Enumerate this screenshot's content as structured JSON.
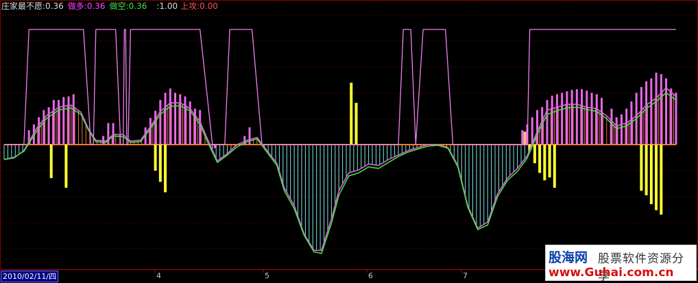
{
  "header": {
    "indicator_name": "庄家最不愿",
    "zjbv": ":0.36",
    "long_label": "做多",
    "long_value": ":0.36",
    "short_label": "做空",
    "short_value": ":0.36",
    "v4": ":1.00",
    "attack_label": "上攻",
    "attack_value": ":0.00"
  },
  "x_axis": {
    "date_label": "2010/02/11/四",
    "month_labels": [
      "4",
      "5",
      "6",
      "7"
    ]
  },
  "watermark": {
    "brand": "股海网",
    "tagline": "股票软件资源分享",
    "url": "www.Guhai.com.cn"
  },
  "colors": {
    "background": "#000000",
    "grid": "#8b0000",
    "zero_line": "#ff7a1a",
    "long_line": "#e060e0",
    "short_line": "#40e040",
    "positive_hist": "#e07a4a",
    "negative_hist": "#7fe8e8",
    "signal": "#ffff30",
    "signal_light": "#ffc080",
    "attack_bar": "#e868e8",
    "step_line": "#f080f0",
    "label_name": "#d8d8d8",
    "label_long": "#ff40ff",
    "label_short": "#40e040",
    "label_attack": "#ff5050"
  },
  "chart_data": {
    "type": "line",
    "title": "",
    "xlabel": "",
    "ylabel": "",
    "ylim": [
      -1.6,
      1.8
    ],
    "zero": 0,
    "grid": true,
    "bars_count": 138,
    "series": [
      {
        "name": "做多",
        "points": [
          [
            0,
            -0.2
          ],
          [
            4,
            -0.18
          ],
          [
            8,
            -0.08
          ],
          [
            13,
            0.22
          ],
          [
            17,
            0.4
          ],
          [
            22,
            0.52
          ],
          [
            27,
            0.55
          ],
          [
            31,
            0.45
          ],
          [
            34,
            0.22
          ],
          [
            37,
            0.06
          ],
          [
            41,
            0.05
          ],
          [
            44,
            0.14
          ],
          [
            48,
            0.14
          ],
          [
            51,
            0.05
          ],
          [
            55,
            0.06
          ],
          [
            59,
            0.25
          ],
          [
            63,
            0.46
          ],
          [
            67,
            0.58
          ],
          [
            71,
            0.58
          ],
          [
            75,
            0.5
          ],
          [
            79,
            0.32
          ],
          [
            82,
            0.08
          ],
          [
            86,
            -0.22
          ],
          [
            90,
            -0.12
          ],
          [
            94,
            0.0
          ],
          [
            98,
            0.06
          ],
          [
            102,
            0.1
          ],
          [
            106,
            -0.08
          ],
          [
            110,
            -0.25
          ],
          [
            113,
            -0.58
          ],
          [
            117,
            -0.82
          ],
          [
            121,
            -1.2
          ],
          [
            125,
            -1.42
          ],
          [
            128,
            -1.42
          ],
          [
            132,
            -1.0
          ],
          [
            135,
            -0.62
          ],
          [
            139,
            -0.38
          ],
          [
            143,
            -0.34
          ],
          [
            147,
            -0.26
          ],
          [
            151,
            -0.28
          ],
          [
            155,
            -0.2
          ],
          [
            159,
            -0.14
          ],
          [
            163,
            -0.08
          ],
          [
            167,
            -0.04
          ],
          [
            171,
            0.0
          ],
          [
            175,
            0.0
          ],
          [
            179,
            -0.04
          ],
          [
            183,
            -0.28
          ],
          [
            187,
            -0.82
          ],
          [
            191,
            -1.12
          ],
          [
            195,
            -1.04
          ],
          [
            199,
            -0.66
          ],
          [
            203,
            -0.45
          ],
          [
            207,
            -0.32
          ],
          [
            211,
            -0.15
          ],
          [
            215,
            0.18
          ],
          [
            219,
            0.48
          ],
          [
            223,
            0.52
          ],
          [
            227,
            0.56
          ],
          [
            231,
            0.56
          ],
          [
            235,
            0.52
          ],
          [
            239,
            0.5
          ],
          [
            243,
            0.4
          ],
          [
            247,
            0.26
          ],
          [
            251,
            0.3
          ],
          [
            255,
            0.4
          ],
          [
            259,
            0.55
          ],
          [
            263,
            0.65
          ],
          [
            267,
            0.79
          ],
          [
            271,
            0.67
          ]
        ]
      },
      {
        "name": "做空",
        "points": [
          [
            0,
            -0.2
          ],
          [
            4,
            -0.17
          ],
          [
            8,
            -0.09
          ],
          [
            13,
            0.18
          ],
          [
            17,
            0.36
          ],
          [
            22,
            0.48
          ],
          [
            27,
            0.51
          ],
          [
            31,
            0.42
          ],
          [
            34,
            0.2
          ],
          [
            37,
            0.04
          ],
          [
            41,
            0.03
          ],
          [
            44,
            0.12
          ],
          [
            48,
            0.11
          ],
          [
            51,
            0.03
          ],
          [
            55,
            0.04
          ],
          [
            59,
            0.22
          ],
          [
            63,
            0.42
          ],
          [
            67,
            0.53
          ],
          [
            71,
            0.54
          ],
          [
            75,
            0.47
          ],
          [
            79,
            0.28
          ],
          [
            82,
            0.04
          ],
          [
            86,
            -0.24
          ],
          [
            90,
            -0.14
          ],
          [
            94,
            -0.03
          ],
          [
            98,
            0.04
          ],
          [
            102,
            0.08
          ],
          [
            106,
            -0.1
          ],
          [
            110,
            -0.28
          ],
          [
            113,
            -0.62
          ],
          [
            117,
            -0.86
          ],
          [
            121,
            -1.22
          ],
          [
            125,
            -1.44
          ],
          [
            128,
            -1.46
          ],
          [
            132,
            -1.06
          ],
          [
            135,
            -0.68
          ],
          [
            139,
            -0.42
          ],
          [
            143,
            -0.38
          ],
          [
            147,
            -0.3
          ],
          [
            151,
            -0.32
          ],
          [
            155,
            -0.24
          ],
          [
            159,
            -0.16
          ],
          [
            163,
            -0.1
          ],
          [
            167,
            -0.06
          ],
          [
            171,
            -0.02
          ],
          [
            175,
            -0.01
          ],
          [
            179,
            -0.05
          ],
          [
            183,
            -0.3
          ],
          [
            187,
            -0.84
          ],
          [
            191,
            -1.14
          ],
          [
            195,
            -1.08
          ],
          [
            199,
            -0.7
          ],
          [
            203,
            -0.48
          ],
          [
            207,
            -0.36
          ],
          [
            211,
            -0.18
          ],
          [
            215,
            0.14
          ],
          [
            219,
            0.42
          ],
          [
            223,
            0.47
          ],
          [
            227,
            0.51
          ],
          [
            231,
            0.52
          ],
          [
            235,
            0.49
          ],
          [
            239,
            0.46
          ],
          [
            243,
            0.36
          ],
          [
            247,
            0.22
          ],
          [
            251,
            0.26
          ],
          [
            255,
            0.36
          ],
          [
            259,
            0.5
          ],
          [
            263,
            0.6
          ],
          [
            267,
            0.72
          ],
          [
            271,
            0.62
          ]
        ]
      },
      {
        "name": "上攻",
        "type": "step",
        "points": [
          [
            0,
            0.0
          ],
          [
            8,
            0.0
          ],
          [
            10,
            1.6
          ],
          [
            32,
            1.6
          ],
          [
            35,
            0.0
          ],
          [
            36,
            0.0
          ],
          [
            37,
            1.6
          ],
          [
            45,
            1.6
          ],
          [
            47,
            0.0
          ],
          [
            48,
            0.0
          ],
          [
            48.5,
            1.6
          ],
          [
            49,
            1.6
          ],
          [
            49.5,
            0.0
          ],
          [
            50,
            0.0
          ],
          [
            51,
            1.6
          ],
          [
            79,
            1.6
          ],
          [
            84,
            0.0
          ],
          [
            89,
            0.0
          ],
          [
            91,
            1.6
          ],
          [
            100,
            1.6
          ],
          [
            104,
            0.0
          ],
          [
            159,
            0.0
          ],
          [
            161,
            1.6
          ],
          [
            164,
            1.6
          ],
          [
            166,
            0.0
          ],
          [
            169,
            1.6
          ],
          [
            178,
            1.6
          ],
          [
            181,
            0.0
          ],
          [
            211,
            0.0
          ],
          [
            212,
            1.6
          ],
          [
            271,
            1.6
          ]
        ]
      },
      {
        "name": "上攻柱",
        "type": "bar",
        "points": [
          [
            10,
            0.2
          ],
          [
            12,
            0.28
          ],
          [
            14,
            0.38
          ],
          [
            16,
            0.48
          ],
          [
            18,
            0.52
          ],
          [
            20,
            0.62
          ],
          [
            22,
            0.62
          ],
          [
            24,
            0.66
          ],
          [
            26,
            0.67
          ],
          [
            28,
            0.7
          ],
          [
            40,
            0.12
          ],
          [
            42,
            0.3
          ],
          [
            44,
            0.3
          ],
          [
            57,
            0.24
          ],
          [
            59,
            0.37
          ],
          [
            61,
            0.47
          ],
          [
            63,
            0.62
          ],
          [
            65,
            0.72
          ],
          [
            67,
            0.78
          ],
          [
            69,
            0.72
          ],
          [
            71,
            0.7
          ],
          [
            73,
            0.67
          ],
          [
            75,
            0.6
          ],
          [
            77,
            0.5
          ],
          [
            79,
            0.48
          ],
          [
            85,
            -0.05
          ],
          [
            97,
            0.12
          ],
          [
            99,
            0.24
          ],
          [
            209,
            0.2
          ],
          [
            211,
            0.28
          ],
          [
            213,
            0.38
          ],
          [
            215,
            0.48
          ],
          [
            217,
            0.52
          ],
          [
            219,
            0.62
          ],
          [
            221,
            0.68
          ],
          [
            223,
            0.7
          ],
          [
            225,
            0.72
          ],
          [
            227,
            0.74
          ],
          [
            229,
            0.76
          ],
          [
            231,
            0.77
          ],
          [
            233,
            0.77
          ],
          [
            235,
            0.75
          ],
          [
            237,
            0.72
          ],
          [
            239,
            0.7
          ],
          [
            241,
            0.65
          ],
          [
            245,
            0.5
          ],
          [
            247,
            0.38
          ],
          [
            249,
            0.42
          ],
          [
            251,
            0.5
          ],
          [
            253,
            0.6
          ],
          [
            255,
            0.72
          ],
          [
            257,
            0.8
          ],
          [
            259,
            0.88
          ],
          [
            261,
            0.92
          ],
          [
            263,
            1.0
          ],
          [
            265,
            0.98
          ],
          [
            267,
            0.92
          ],
          [
            269,
            0.78
          ],
          [
            271,
            0.72
          ]
        ]
      },
      {
        "name": "信号",
        "type": "bar",
        "points": [
          [
            19,
            -0.45
          ],
          [
            25,
            -0.58
          ],
          [
            61,
            -0.35
          ],
          [
            63,
            -0.5
          ],
          [
            65,
            -0.64
          ],
          [
            140,
            0.86
          ],
          [
            142,
            0.58
          ],
          [
            210,
            0.18
          ],
          [
            212,
            -0.08
          ],
          [
            214,
            -0.25
          ],
          [
            216,
            -0.38
          ],
          [
            218,
            -0.48
          ],
          [
            220,
            -0.44
          ],
          [
            222,
            -0.58
          ],
          [
            257,
            -0.62
          ],
          [
            259,
            -0.68
          ],
          [
            261,
            -0.8
          ],
          [
            263,
            -0.88
          ],
          [
            265,
            -0.94
          ]
        ]
      }
    ]
  }
}
